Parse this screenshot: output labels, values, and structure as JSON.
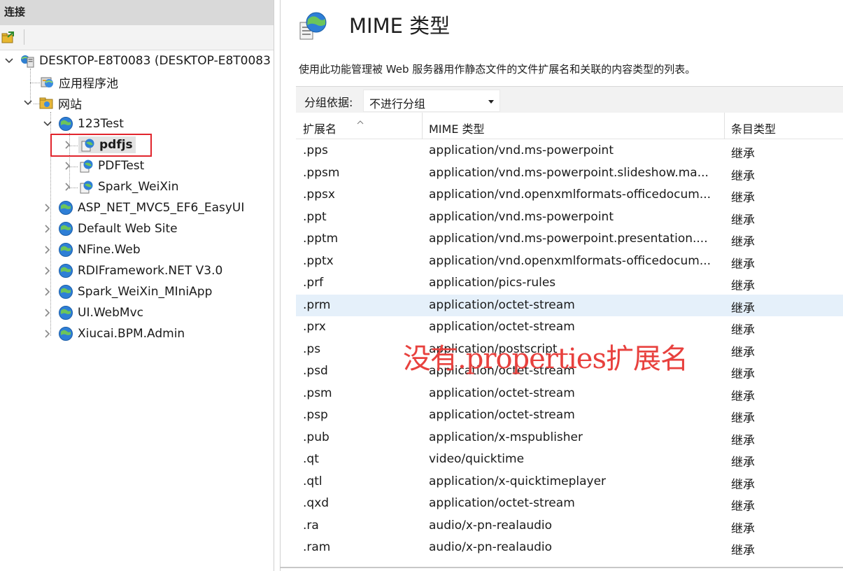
{
  "connections": {
    "header": "连接",
    "tree": [
      {
        "label": "DESKTOP-E8T0083 (DESKTOP-E8T0083",
        "icon": "server-icon",
        "expanded": true
      },
      {
        "label": "应用程序池",
        "icon": "app-pool-icon"
      },
      {
        "label": "网站",
        "icon": "sites-folder-icon",
        "expanded": true
      },
      {
        "label": "123Test",
        "icon": "globe-icon",
        "expanded": true
      },
      {
        "label": "pdfjs",
        "icon": "application-icon",
        "selected": true
      },
      {
        "label": "PDFTest",
        "icon": "application-icon"
      },
      {
        "label": "Spark_WeiXin",
        "icon": "application-icon"
      },
      {
        "label": "ASP_NET_MVC5_EF6_EasyUI",
        "icon": "globe-icon"
      },
      {
        "label": "Default Web Site",
        "icon": "globe-icon"
      },
      {
        "label": "NFine.Web",
        "icon": "globe-icon"
      },
      {
        "label": "RDIFramework.NET V3.0",
        "icon": "globe-icon"
      },
      {
        "label": "Spark_WeiXin_MIniApp",
        "icon": "globe-icon"
      },
      {
        "label": "UI.WebMvc",
        "icon": "globe-icon"
      },
      {
        "label": "Xiucai.BPM.Admin",
        "icon": "globe-icon"
      }
    ]
  },
  "feature": {
    "title": "MIME 类型",
    "description": "使用此功能管理被 Web 服务器用作静态文件的文件扩展名和关联的内容类型的列表。",
    "group_by_label": "分组依据:",
    "group_by_value": "不进行分组"
  },
  "grid": {
    "columns": [
      "扩展名",
      "MIME 类型",
      "条目类型"
    ],
    "rows": [
      [
        ".pps",
        "application/vnd.ms-powerpoint",
        "继承"
      ],
      [
        ".ppsm",
        "application/vnd.ms-powerpoint.slideshow.ma...",
        "继承"
      ],
      [
        ".ppsx",
        "application/vnd.openxmlformats-officedocum...",
        "继承"
      ],
      [
        ".ppt",
        "application/vnd.ms-powerpoint",
        "继承"
      ],
      [
        ".pptm",
        "application/vnd.ms-powerpoint.presentation....",
        "继承"
      ],
      [
        ".pptx",
        "application/vnd.openxmlformats-officedocum...",
        "继承"
      ],
      [
        ".prf",
        "application/pics-rules",
        "继承"
      ],
      [
        ".prm",
        "application/octet-stream",
        "继承"
      ],
      [
        ".prx",
        "application/octet-stream",
        "继承"
      ],
      [
        ".ps",
        "application/postscript",
        "继承"
      ],
      [
        ".psd",
        "application/octet-stream",
        "继承"
      ],
      [
        ".psm",
        "application/octet-stream",
        "继承"
      ],
      [
        ".psp",
        "application/octet-stream",
        "继承"
      ],
      [
        ".pub",
        "application/x-mspublisher",
        "继承"
      ],
      [
        ".qt",
        "video/quicktime",
        "继承"
      ],
      [
        ".qtl",
        "application/x-quicktimeplayer",
        "继承"
      ],
      [
        ".qxd",
        "application/octet-stream",
        "继承"
      ],
      [
        ".ra",
        "audio/x-pn-realaudio",
        "继承"
      ],
      [
        ".ram",
        "audio/x-pn-realaudio",
        "继承"
      ]
    ],
    "selected_row": 7
  },
  "annotation": {
    "text": "没有.properties扩展名",
    "color": "#e8413e"
  }
}
